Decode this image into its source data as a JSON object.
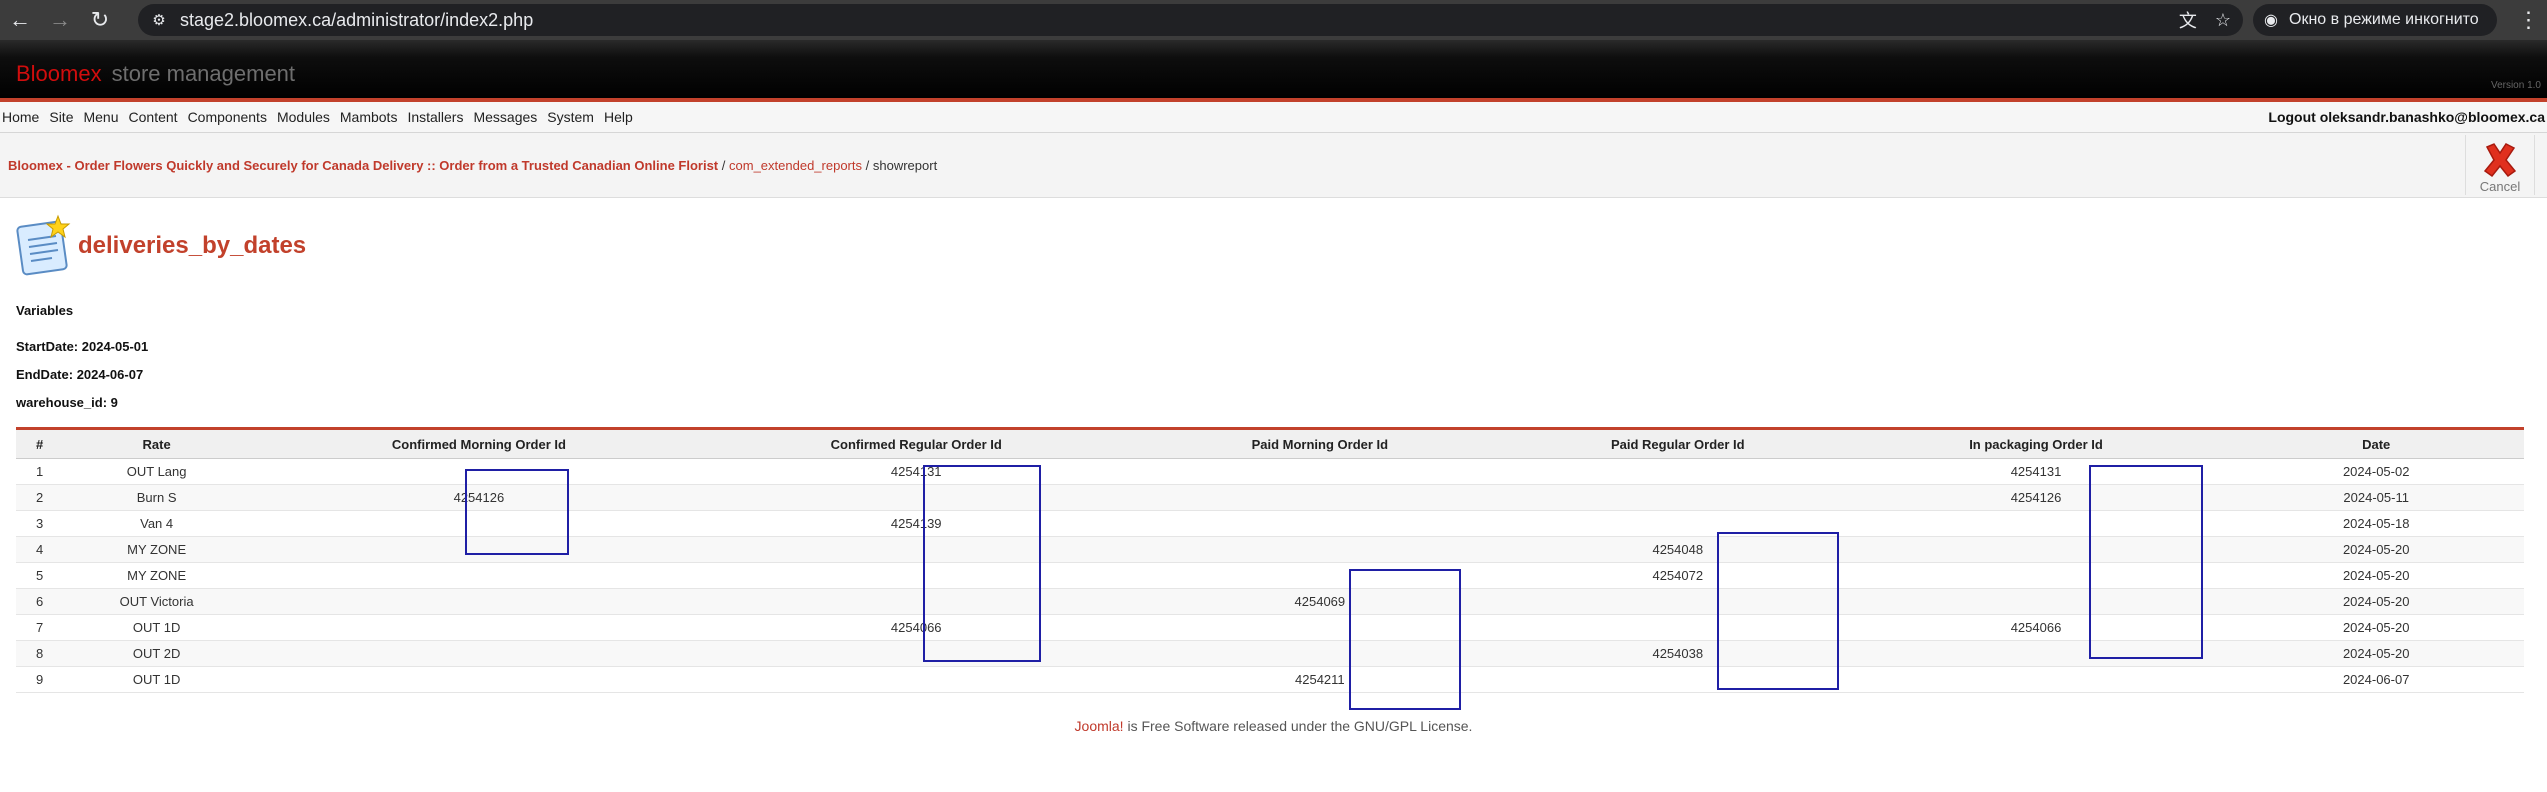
{
  "browser": {
    "url": "stage2.bloomex.ca/administrator/index2.php",
    "incognito_label": "Окно в режиме инкогнито"
  },
  "header": {
    "brand_name": "Bloomex",
    "brand_suffix": "store management",
    "version": "Version 1.0"
  },
  "menu": {
    "items": [
      "Home",
      "Site",
      "Menu",
      "Content",
      "Components",
      "Modules",
      "Mambots",
      "Installers",
      "Messages",
      "System",
      "Help"
    ],
    "logout_label": "Logout",
    "user": "oleksandr.banashko@bloomex.ca"
  },
  "breadcrumb": {
    "site": "Bloomex - Order Flowers Quickly and Securely for Canada Delivery :: Order from a Trusted Canadian Online Florist",
    "component": "com_extended_reports",
    "current": "showreport",
    "separator": "/"
  },
  "toolbar": {
    "cancel_label": "Cancel"
  },
  "report": {
    "title": "deliveries_by_dates",
    "variables_heading": "Variables",
    "variables": [
      {
        "name": "StartDate:",
        "value": "2024-05-01"
      },
      {
        "name": "EndDate:",
        "value": "2024-06-07"
      },
      {
        "name": "warehouse_id:",
        "value": "9"
      }
    ],
    "columns": [
      "#",
      "Rate",
      "Confirmed Morning Order Id",
      "Confirmed Regular Order Id",
      "Paid Morning Order Id",
      "Paid Regular Order Id",
      "In packaging Order Id",
      "Date"
    ],
    "rows": [
      [
        "1",
        "OUT Lang",
        "",
        "4254131",
        "",
        "",
        "4254131",
        "2024-05-02"
      ],
      [
        "2",
        "Burn S",
        "4254126",
        "",
        "",
        "",
        "4254126",
        "2024-05-11"
      ],
      [
        "3",
        "Van 4",
        "",
        "4254139",
        "",
        "",
        "",
        "2024-05-18"
      ],
      [
        "4",
        "MY ZONE",
        "",
        "",
        "",
        "4254048",
        "",
        "2024-05-20"
      ],
      [
        "5",
        "MY ZONE",
        "",
        "",
        "",
        "4254072",
        "",
        "2024-05-20"
      ],
      [
        "6",
        "OUT Victoria",
        "",
        "",
        "4254069",
        "",
        "",
        "2024-05-20"
      ],
      [
        "7",
        "OUT 1D",
        "",
        "4254066",
        "",
        "",
        "4254066",
        "2024-05-20"
      ],
      [
        "8",
        "OUT 2D",
        "",
        "",
        "",
        "4254038",
        "",
        "2024-05-20"
      ],
      [
        "9",
        "OUT 1D",
        "",
        "",
        "4254211",
        "",
        "",
        "2024-06-07"
      ]
    ]
  },
  "footer": {
    "link": "Joomla!",
    "text": " is Free Software released under the GNU/GPL License."
  },
  "colors": {
    "accent": "#c2412b",
    "highlight_box": "#1f1fa5",
    "brand_red": "#d10d0d"
  },
  "icons": [
    "back-arrow-icon",
    "forward-arrow-icon",
    "reload-icon",
    "site-info-icon",
    "translate-icon",
    "star-icon",
    "incognito-icon",
    "menu-dots-icon",
    "cancel-x-icon",
    "report-document-icon"
  ]
}
